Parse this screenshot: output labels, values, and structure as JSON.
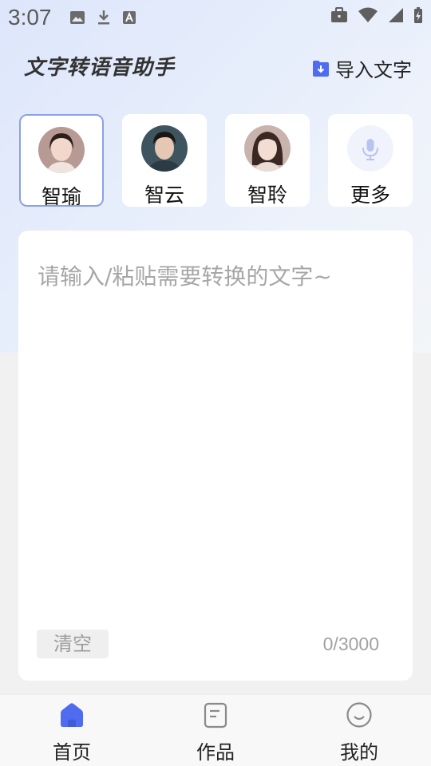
{
  "status": {
    "time": "3:07"
  },
  "header": {
    "title": "文字转语音助手",
    "import_label": "导入文字"
  },
  "voices": [
    {
      "name": "智瑜",
      "selected": true
    },
    {
      "name": "智云",
      "selected": false
    },
    {
      "name": "智聆",
      "selected": false
    },
    {
      "name": "更多",
      "selected": false
    }
  ],
  "editor": {
    "placeholder": "请输入/粘贴需要转换的文字~",
    "clear_label": "清空",
    "char_count": "0/3000"
  },
  "nav": [
    {
      "label": "首页",
      "active": true
    },
    {
      "label": "作品",
      "active": false
    },
    {
      "label": "我的",
      "active": false
    }
  ],
  "colors": {
    "accent": "#4f6cf0",
    "selected_border": "#8aa1e8"
  }
}
